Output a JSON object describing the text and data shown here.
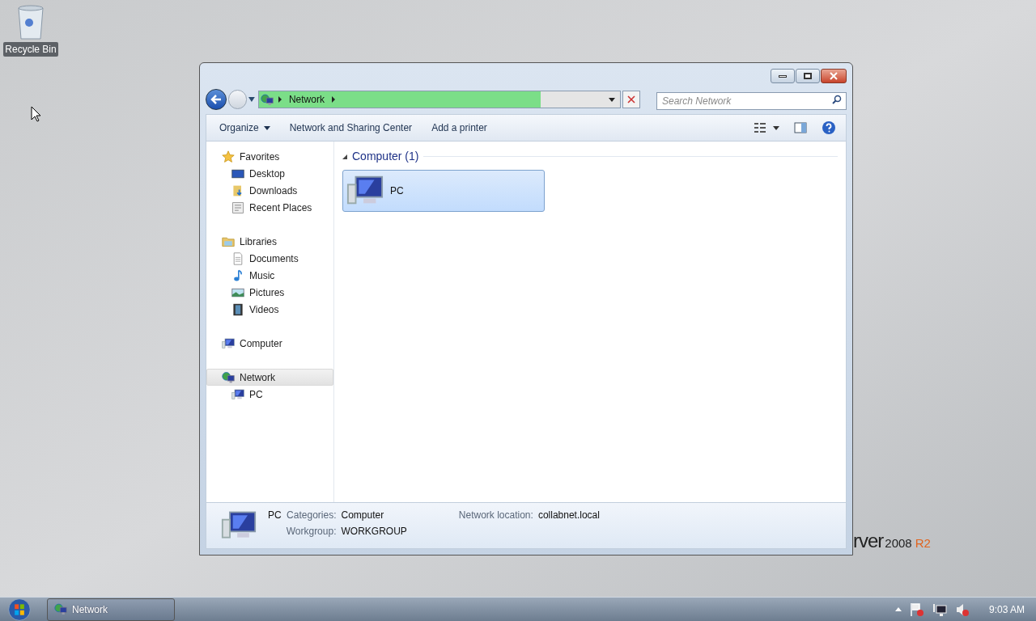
{
  "desktop": {
    "icons": [
      {
        "label": "Recycle Bin"
      }
    ],
    "wallpaper_brand": {
      "text": "rver",
      "version": "2008",
      "edition": "R2"
    }
  },
  "window": {
    "address": {
      "location": "Network",
      "level": 0.78
    },
    "search": {
      "placeholder": "Search Network"
    },
    "toolbar": {
      "items": [
        {
          "label": "Organize",
          "kind": "menu"
        },
        {
          "label": "Network and Sharing Center",
          "kind": "command"
        },
        {
          "label": "Add a printer",
          "kind": "command"
        }
      ]
    },
    "sidebar": {
      "items": [
        {
          "label": "Favorites",
          "selected": false,
          "children": [
            {
              "label": "Desktop",
              "selected": false
            },
            {
              "label": "Downloads",
              "selected": false
            },
            {
              "label": "Recent Places",
              "selected": false
            }
          ]
        },
        {
          "label": "Libraries",
          "selected": false,
          "children": [
            {
              "label": "Documents",
              "selected": false
            },
            {
              "label": "Music",
              "selected": false
            },
            {
              "label": "Pictures",
              "selected": false
            },
            {
              "label": "Videos",
              "selected": false
            }
          ]
        },
        {
          "label": "Computer",
          "selected": false
        },
        {
          "label": "Network",
          "selected": true,
          "children": [
            {
              "label": "PC",
              "selected": false
            }
          ]
        }
      ]
    },
    "group": {
      "title": "Computer (1)",
      "expanded": true,
      "items": [
        {
          "label": "PC",
          "selected": true
        }
      ]
    },
    "details": {
      "name": "PC",
      "fields": [
        {
          "label": "Categories:",
          "value": "Computer"
        },
        {
          "label": "Workgroup:",
          "value": "WORKGROUP"
        },
        {
          "label": "Network location:",
          "value": "collabnet.local"
        }
      ]
    }
  },
  "taskbar": {
    "buttons": [
      {
        "label": "Network"
      }
    ],
    "clock": "9:03 AM"
  }
}
